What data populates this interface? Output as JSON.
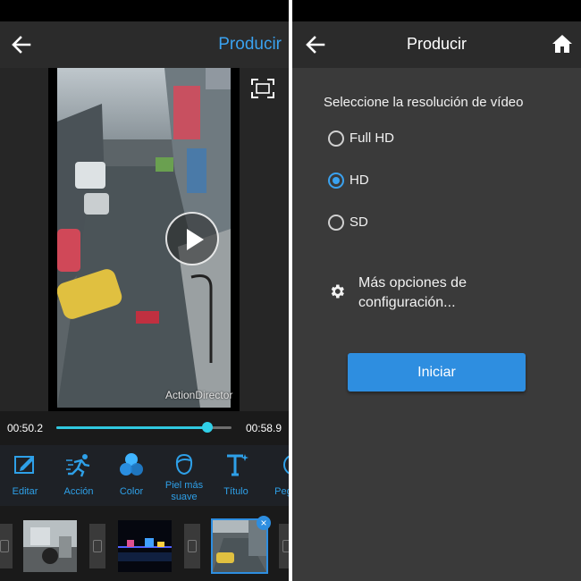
{
  "editor": {
    "header": {
      "produce_label": "Producir"
    },
    "preview": {
      "watermark": "ActionDirector"
    },
    "timeline": {
      "current_time": "00:50.2",
      "total_time": "00:58.9",
      "progress": 0.86
    },
    "tools": [
      {
        "label": "Editar",
        "icon": "edit-icon"
      },
      {
        "label": "Acción",
        "icon": "action-icon"
      },
      {
        "label": "Color",
        "icon": "color-icon"
      },
      {
        "label": "Piel más suave",
        "icon": "skin-smooth-icon"
      },
      {
        "label": "Título",
        "icon": "title-icon"
      },
      {
        "label": "Pega",
        "icon": "sticker-icon"
      }
    ],
    "remove_clip_symbol": "×"
  },
  "produce": {
    "header": {
      "title": "Producir"
    },
    "resolution_title": "Seleccione la resolución de vídeo",
    "options": [
      {
        "label": "Full HD",
        "selected": false
      },
      {
        "label": "HD",
        "selected": true
      },
      {
        "label": "SD",
        "selected": false
      }
    ],
    "more_options_label": "Más opciones de configuración...",
    "start_button": "Iniciar"
  },
  "colors": {
    "accent": "#3aa2f0",
    "timeline": "#30c8e0",
    "button": "#2e8ee0"
  }
}
